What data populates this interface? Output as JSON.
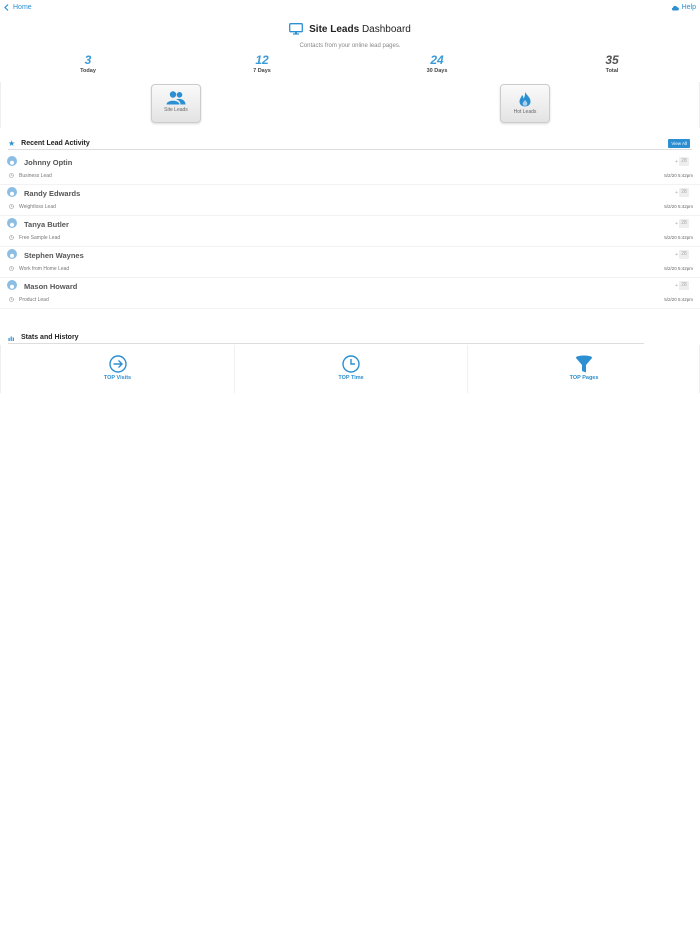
{
  "nav": {
    "back_label": "Home",
    "help_label": "Help"
  },
  "header": {
    "title_bold": "Site Leads",
    "title_rest": "Dashboard",
    "subtitle": "Contacts from your online lead pages."
  },
  "stats": [
    {
      "value": "3",
      "label": "Today"
    },
    {
      "value": "12",
      "label": "7 Days"
    },
    {
      "value": "24",
      "label": "30 Days"
    },
    {
      "value": "35",
      "label": "Total"
    }
  ],
  "tiles": {
    "site_leads": "Site Leads",
    "hot_leads": "Hot Leads"
  },
  "recent": {
    "title": "Recent Lead Activity",
    "view_all": "View All",
    "leads": [
      {
        "name": "Johnny Optin",
        "type": "Business Lead",
        "time": "5/2/20 5:42pm",
        "plus": "+",
        "badge": "28"
      },
      {
        "name": "Randy Edwards",
        "type": "Weightloss Lead",
        "time": "5/2/20 5:42pm",
        "plus": "+",
        "badge": "28"
      },
      {
        "name": "Tanya Butler",
        "type": "Free Sample Lead",
        "time": "5/2/20 5:42pm",
        "plus": "+",
        "badge": "28"
      },
      {
        "name": "Stephen Waynes",
        "type": "Work from Home Lead",
        "time": "5/2/20 5:42pm",
        "plus": "+",
        "badge": "28"
      },
      {
        "name": "Mason Howard",
        "type": "Product Lead",
        "time": "5/2/20 5:42pm",
        "plus": "+",
        "badge": "28"
      }
    ]
  },
  "history": {
    "title": "Stats and History",
    "items": [
      {
        "label": "TOP Visits",
        "icon": "arrow-circle-icon"
      },
      {
        "label": "TOP Time",
        "icon": "clock-icon"
      },
      {
        "label": "TOP Pages",
        "icon": "funnel-icon"
      }
    ]
  },
  "colors": {
    "accent": "#2b8fd1",
    "stat_blue": "#3a9bd9"
  }
}
